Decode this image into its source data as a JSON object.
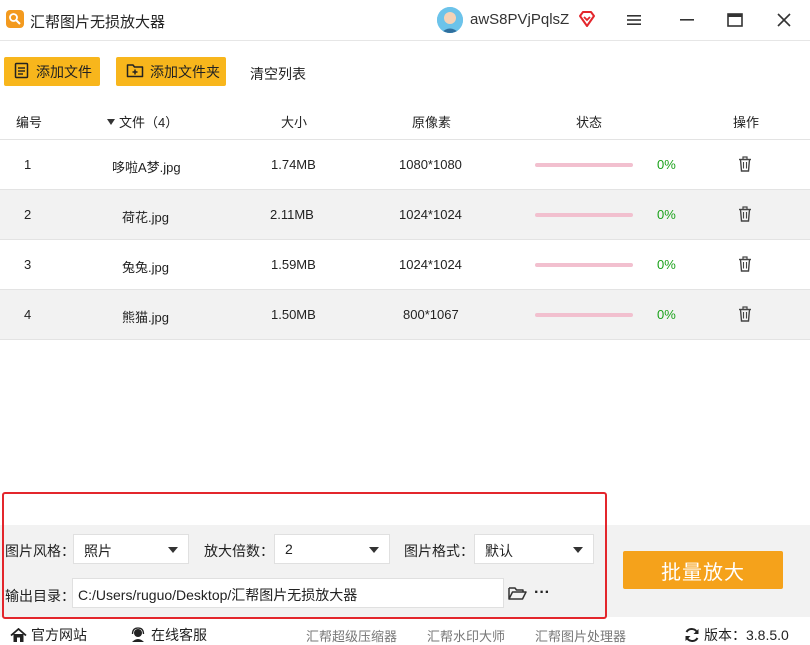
{
  "app": {
    "title": "汇帮图片无损放大器",
    "username": "awS8PVjPqlsZ"
  },
  "colors": {
    "accent": "#f8b61c",
    "primary_button": "#f5a21b",
    "progress_track": "#f2c0cf",
    "percent_text": "#1aa21a",
    "highlight_frame": "#e3262c"
  },
  "toolbar": {
    "add_file": "添加文件",
    "add_folder": "添加文件夹",
    "clear_list": "清空列表"
  },
  "table": {
    "headers": {
      "index": "编号",
      "file": "文件（4）",
      "size": "大小",
      "pixels": "原像素",
      "status": "状态",
      "action": "操作"
    },
    "rows": [
      {
        "index": "1",
        "name": "哆啦A梦.jpg",
        "size": "1.74MB",
        "pixels": "1080*1080",
        "progress": 0,
        "percent": "0%"
      },
      {
        "index": "2",
        "name": "荷花.jpg",
        "size": "2.11MB",
        "pixels": "1024*1024",
        "progress": 0,
        "percent": "0%"
      },
      {
        "index": "3",
        "name": "兔兔.jpg",
        "size": "1.59MB",
        "pixels": "1024*1024",
        "progress": 0,
        "percent": "0%"
      },
      {
        "index": "4",
        "name": "熊猫.jpg",
        "size": "1.50MB",
        "pixels": "800*1067",
        "progress": 0,
        "percent": "0%"
      }
    ]
  },
  "settings": {
    "style_label": "图片风格：",
    "style_value": "照片",
    "scale_label": "放大倍数：",
    "scale_value": "2",
    "format_label": "图片格式：",
    "format_value": "默认",
    "output_label": "输出目录：",
    "output_path": "C:/Users/ruguo/Desktop/汇帮图片无损放大器",
    "more": "···",
    "start_button": "批量放大"
  },
  "footer": {
    "official_site": "官方网站",
    "online_service": "在线客服",
    "link_compress": "汇帮超级压缩器",
    "link_watermark": "汇帮水印大师",
    "link_processor": "汇帮图片处理器",
    "version": "版本：3.8.5.0"
  },
  "icons": [
    "app-logo-icon",
    "vip-heart-icon",
    "menu-icon",
    "minimize-icon",
    "maximize-icon",
    "close-icon",
    "add-file-icon",
    "add-folder-icon",
    "sort-down-icon",
    "trash-icon",
    "folder-open-icon",
    "home-icon",
    "support-icon",
    "refresh-icon"
  ]
}
